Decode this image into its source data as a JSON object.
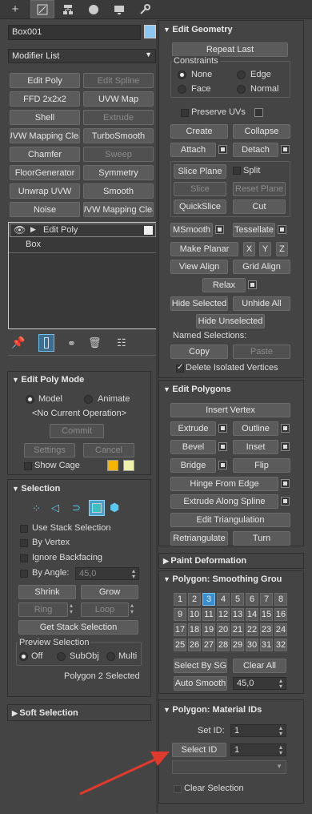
{
  "object_name": "Box001",
  "modifier_list_label": "Modifier List",
  "modifier_buttons": [
    "Edit Poly",
    "Edit Spline",
    "FFD 2x2x2",
    "UVW Map",
    "Shell",
    "Extrude",
    "UVW Mapping Clea",
    "TurboSmooth",
    "Chamfer",
    "Sweep",
    "FloorGenerator",
    "Symmetry",
    "Unwrap UVW",
    "Smooth",
    "Noise",
    "UVW Mapping Clea"
  ],
  "stack": {
    "modifier": "Edit Poly",
    "base": "Box"
  },
  "edit_poly_mode": {
    "title": "Edit Poly Mode",
    "model": "Model",
    "animate": "Animate",
    "current_op": "<No Current Operation>",
    "commit": "Commit",
    "settings": "Settings",
    "cancel": "Cancel",
    "show_cage": "Show Cage"
  },
  "selection": {
    "title": "Selection",
    "use_stack": "Use Stack Selection",
    "by_vertex": "By Vertex",
    "ignore_backfacing": "Ignore Backfacing",
    "by_angle": "By Angle:",
    "angle_value": "45,0",
    "shrink": "Shrink",
    "grow": "Grow",
    "ring": "Ring",
    "loop": "Loop",
    "get_stack": "Get Stack Selection",
    "preview_title": "Preview Selection",
    "off": "Off",
    "subobj": "SubObj",
    "multi": "Multi",
    "status": "Polygon 2 Selected"
  },
  "soft_selection_title": "Soft Selection",
  "edit_geometry": {
    "title": "Edit Geometry",
    "repeat_last": "Repeat Last",
    "constraints": "Constraints",
    "none": "None",
    "edge": "Edge",
    "face": "Face",
    "normal": "Normal",
    "preserve_uvs": "Preserve UVs",
    "create": "Create",
    "collapse": "Collapse",
    "attach": "Attach",
    "detach": "Detach",
    "slice_plane": "Slice Plane",
    "split": "Split",
    "slice": "Slice",
    "reset_plane": "Reset Plane",
    "quickslice": "QuickSlice",
    "cut": "Cut",
    "msmooth": "MSmooth",
    "tessellate": "Tessellate",
    "make_planar": "Make Planar",
    "x": "X",
    "y": "Y",
    "z": "Z",
    "view_align": "View Align",
    "grid_align": "Grid Align",
    "relax": "Relax",
    "hide_selected": "Hide Selected",
    "unhide_all": "Unhide All",
    "hide_unselected": "Hide Unselected",
    "named_selections": "Named Selections:",
    "copy": "Copy",
    "paste": "Paste",
    "delete_isolated": "Delete Isolated Vertices"
  },
  "edit_polygons": {
    "title": "Edit Polygons",
    "insert_vertex": "Insert Vertex",
    "extrude": "Extrude",
    "outline": "Outline",
    "bevel": "Bevel",
    "inset": "Inset",
    "bridge": "Bridge",
    "flip": "Flip",
    "hinge": "Hinge From Edge",
    "extrude_spline": "Extrude Along Spline",
    "edit_triangulation": "Edit Triangulation",
    "retriangulate": "Retriangulate",
    "turn": "Turn"
  },
  "paint_deformation_title": "Paint Deformation",
  "smoothing": {
    "title": "Polygon: Smoothing Grou",
    "groups": [
      "1",
      "2",
      "3",
      "4",
      "5",
      "6",
      "7",
      "8",
      "9",
      "10",
      "11",
      "12",
      "13",
      "14",
      "15",
      "16",
      "17",
      "18",
      "19",
      "20",
      "21",
      "22",
      "23",
      "24",
      "25",
      "26",
      "27",
      "28",
      "29",
      "30",
      "31",
      "32"
    ],
    "active_group": "3",
    "select_by_sg": "Select By SG",
    "clear_all": "Clear All",
    "auto_smooth": "Auto Smooth",
    "auto_value": "45,0"
  },
  "material_ids": {
    "title": "Polygon: Material IDs",
    "set_id": "Set ID:",
    "set_value": "1",
    "select_id": "Select ID",
    "select_value": "1",
    "clear_selection": "Clear Selection"
  },
  "colors": {
    "annotation_arrow": "#e03a2f",
    "object_color": "#8ec8f0",
    "active_blue": "#4a9fc8"
  }
}
